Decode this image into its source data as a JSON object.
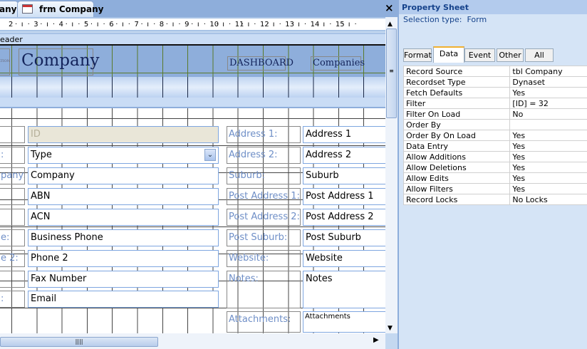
{
  "tabs": {
    "prev_tab": "any",
    "active_tab": "frm Company",
    "close": "×"
  },
  "ruler": [
    "2",
    "3",
    "4",
    "5",
    "6",
    "7",
    "8",
    "9",
    "10",
    "11",
    "12",
    "13",
    "14",
    "15"
  ],
  "sections": {
    "header_label": "eader"
  },
  "header": {
    "logo_text": "ATION",
    "title": "Company",
    "dashboard": "DASHBOARD",
    "companies": "Companies"
  },
  "left_fields": [
    {
      "label": "",
      "value": "ID"
    },
    {
      "label": ":",
      "value": "Type"
    },
    {
      "label": "pany:",
      "value": "Company"
    },
    {
      "label": "",
      "value": "ABN"
    },
    {
      "label": "",
      "value": "ACN"
    },
    {
      "label": "e:",
      "value": "Business Phone"
    },
    {
      "label": "e 2:",
      "value": "Phone 2"
    },
    {
      "label": "",
      "value": "Fax Number"
    },
    {
      "label": ":",
      "value": "Email"
    }
  ],
  "right_fields": [
    {
      "label": "Address 1:",
      "value": "Address 1"
    },
    {
      "label": "Address 2:",
      "value": "Address 2"
    },
    {
      "label": "Suburb:",
      "value": "Suburb"
    },
    {
      "label": "Post Address 1:",
      "value": "Post Address 1"
    },
    {
      "label": "Post Address 2:",
      "value": "Post Address 2"
    },
    {
      "label": "Post Suburb:",
      "value": "Post Suburb"
    },
    {
      "label": "Website:",
      "value": "Website"
    },
    {
      "label": "Notes:",
      "value": "Notes"
    },
    {
      "label": "Attachments:",
      "value": "Attachments"
    }
  ],
  "property_sheet": {
    "title": "Property Sheet",
    "selection_label": "Selection type:",
    "selection_value": "Form",
    "tabs": [
      "Format",
      "Data",
      "Event",
      "Other",
      "All"
    ],
    "active_tab": "Data",
    "rows": [
      [
        "Record Source",
        "tbl Company"
      ],
      [
        "Recordset Type",
        "Dynaset"
      ],
      [
        "Fetch Defaults",
        "Yes"
      ],
      [
        "Filter",
        "[ID] = 32"
      ],
      [
        "Filter On Load",
        "No"
      ],
      [
        "Order By",
        ""
      ],
      [
        "Order By On Load",
        "Yes"
      ],
      [
        "Data Entry",
        "Yes"
      ],
      [
        "Allow Additions",
        "Yes"
      ],
      [
        "Allow Deletions",
        "Yes"
      ],
      [
        "Allow Edits",
        "Yes"
      ],
      [
        "Allow Filters",
        "Yes"
      ],
      [
        "Record Locks",
        "No Locks"
      ]
    ]
  }
}
